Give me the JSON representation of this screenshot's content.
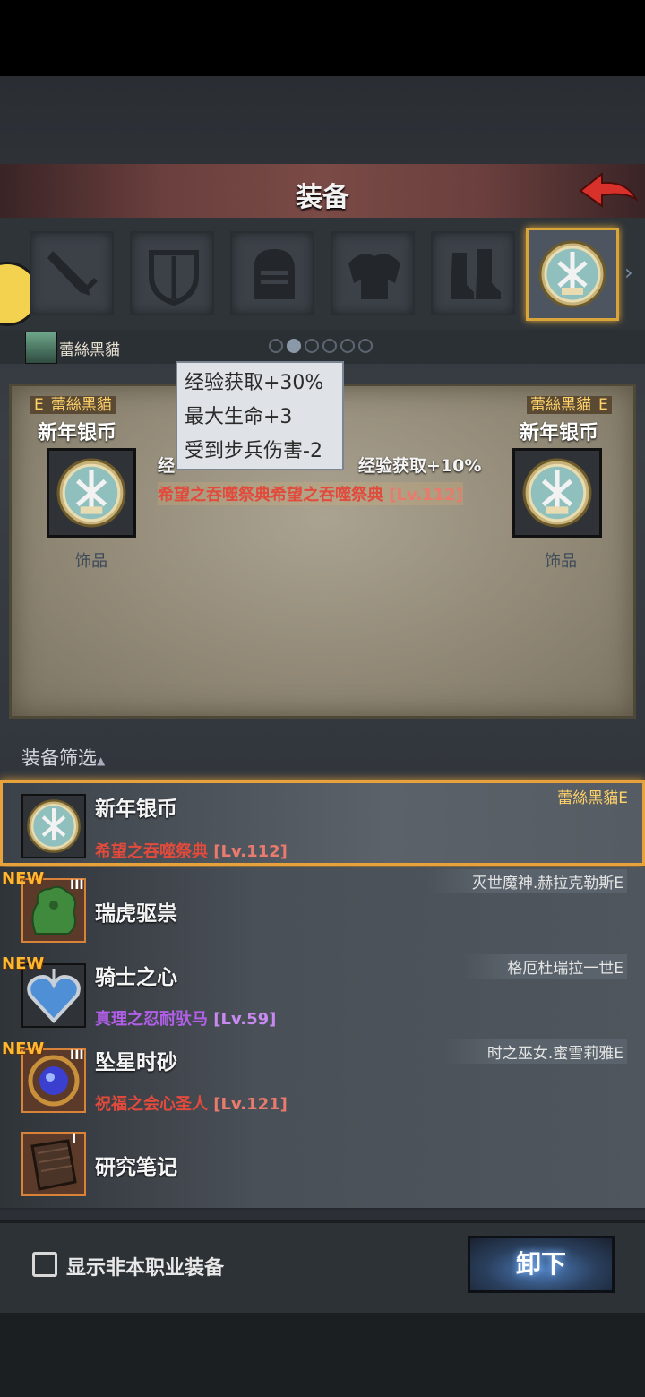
{
  "header": {
    "title": "装备"
  },
  "tabs": [
    {
      "icon": "sword-icon"
    },
    {
      "icon": "shield-icon"
    },
    {
      "icon": "helmet-icon"
    },
    {
      "icon": "armor-icon"
    },
    {
      "icon": "boots-icon"
    },
    {
      "icon": "coin-icon",
      "selected": true
    }
  ],
  "character": {
    "name": "蕾絲黑貓"
  },
  "compare": {
    "left": {
      "owner": "蕾絲黑貓",
      "owner_grade": "E",
      "name": "新年银币",
      "type": "饰品"
    },
    "right": {
      "owner": "蕾絲黑貓",
      "owner_grade": "E",
      "name": "新年银币",
      "type": "饰品"
    },
    "left_stat_partial": "经",
    "right_stat": "经验获取+10%",
    "set_line": "希望之吞噬祭典希望之吞噬祭典",
    "set_level": "[Lv.112]"
  },
  "tooltip": {
    "lines": [
      "经验获取+30%",
      "最大生命+3",
      "受到步兵伤害-2"
    ]
  },
  "filter": {
    "label": "装备筛选"
  },
  "items": [
    {
      "name": "新年银币",
      "sub": "希望之吞噬祭典",
      "level": "[Lv.112]",
      "owner": "蕾絲黑貓",
      "grade": "E",
      "is_new": false,
      "tier": "",
      "sub_color": "#e24a3c",
      "selected": true
    },
    {
      "name": "瑞虎驱祟",
      "sub": "",
      "level": "",
      "owner": "灭世魔神.赫拉克勒斯",
      "grade": "E",
      "is_new": true,
      "tier": "III",
      "sub_color": "#e24a3c"
    },
    {
      "name": "骑士之心",
      "sub": "真理之忍耐驮马",
      "level": "[Lv.59]",
      "owner": "格厄杜瑞拉一世",
      "grade": "E",
      "is_new": true,
      "tier": "",
      "sub_color": "#b15fe8"
    },
    {
      "name": "坠星时砂",
      "sub": "祝福之会心圣人",
      "level": "[Lv.121]",
      "owner": "时之巫女.蜜雪莉雅",
      "grade": "E",
      "is_new": true,
      "tier": "III",
      "sub_color": "#e24a3c"
    },
    {
      "name": "研究笔记",
      "sub": "",
      "level": "",
      "owner": "",
      "grade": "",
      "is_new": false,
      "tier": "I",
      "sub_color": "#e24a3c"
    }
  ],
  "new_label": "NEW",
  "bottom": {
    "checkbox_label": "显示非本职业装备",
    "unequip_label": "卸下"
  }
}
